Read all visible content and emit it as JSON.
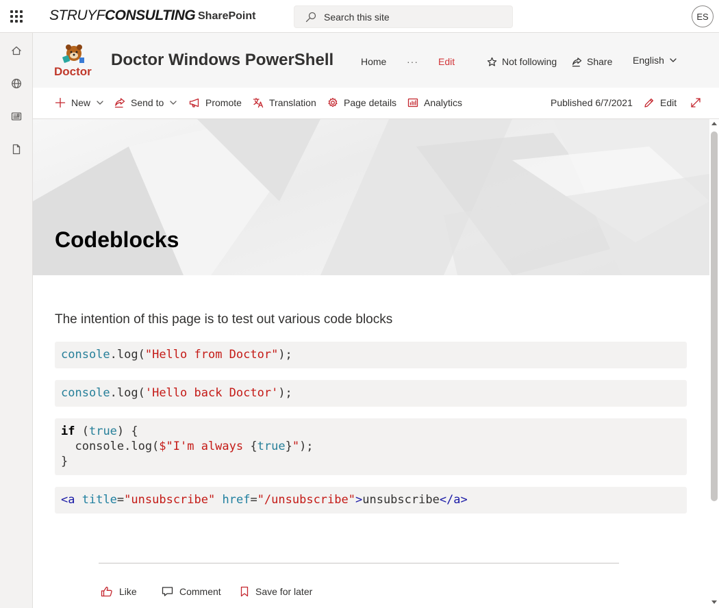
{
  "suite": {
    "brand_thin": "STRUYF",
    "brand_bold": "CONSULTING",
    "app_name": "SharePoint",
    "search_placeholder": "Search this site",
    "user_initials": "ES"
  },
  "appbar": {
    "items": [
      "home-icon",
      "globe-icon",
      "news-icon",
      "page-icon"
    ]
  },
  "site": {
    "logo_text": "Doctor",
    "title": "Doctor Windows PowerShell",
    "nav": {
      "home": "Home",
      "more": "···",
      "edit": "Edit"
    },
    "follow_label": "Not following",
    "share_label": "Share",
    "language": "English"
  },
  "commandbar": {
    "new": "New",
    "send_to": "Send to",
    "promote": "Promote",
    "translation": "Translation",
    "page_details": "Page details",
    "analytics": "Analytics",
    "published": "Published 6/7/2021",
    "edit": "Edit"
  },
  "page": {
    "title": "Codeblocks",
    "intro": "The intention of this page is to test out various code blocks"
  },
  "code": {
    "b1": {
      "obj": "console",
      "mid": ".log(",
      "str": "\"Hello from Doctor\"",
      "end": ");"
    },
    "b2": {
      "obj": "console",
      "mid": ".log(",
      "str": "'Hello back Doctor'",
      "end": ");"
    },
    "b3": {
      "kw": "if",
      "p1": " (",
      "bool": "true",
      "p2": ") {",
      "l2a": "  console.log(",
      "l2b": "$\"I'm always ",
      "l2c": "{",
      "l2d": "true",
      "l2e": "}",
      "l2f": "\"",
      "l2g": ");",
      "l3": "}"
    },
    "b4": {
      "open": "<a",
      "attr1": "title",
      "eq1": "=",
      "val1": "\"unsubscribe\"",
      "attr2": "href",
      "eq2": "=",
      "val2": "\"/unsubscribe\"",
      "gt": ">",
      "text": "unsubscribe",
      "close": "</a>"
    }
  },
  "footer": {
    "like": "Like",
    "comment": "Comment",
    "save": "Save for later"
  },
  "colors": {
    "accent": "#c4262e",
    "suite_bg": "#ffffff",
    "appbar_bg": "#f3f2f1",
    "code_bg": "#f3f2f1"
  }
}
